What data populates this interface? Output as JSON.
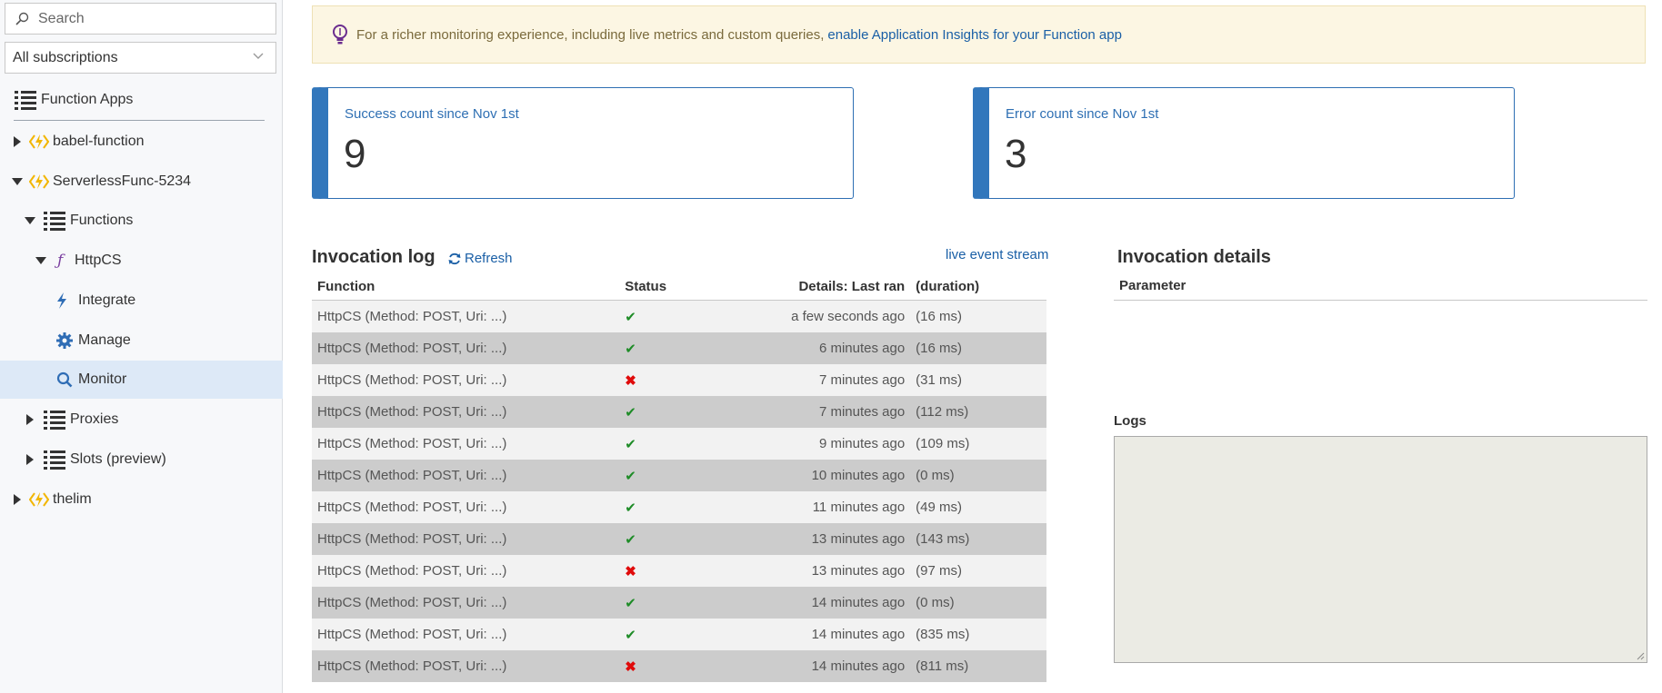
{
  "sidebar": {
    "search_placeholder": "Search",
    "subscription": "All subscriptions",
    "tree": [
      {
        "label": "Function Apps",
        "icon": "list-icon"
      },
      {
        "label": "babel-function",
        "icon": "function-app-icon"
      },
      {
        "label": "ServerlessFunc-5234",
        "icon": "function-app-icon"
      },
      {
        "label": "Functions",
        "icon": "list-icon"
      },
      {
        "label": "HttpCS",
        "icon": "function-icon"
      },
      {
        "label": "Integrate",
        "icon": "lightning-icon"
      },
      {
        "label": "Manage",
        "icon": "gear-icon"
      },
      {
        "label": "Monitor",
        "icon": "search-icon"
      },
      {
        "label": "Proxies",
        "icon": "list-icon"
      },
      {
        "label": "Slots (preview)",
        "icon": "list-icon"
      },
      {
        "label": "thelim",
        "icon": "function-app-icon"
      }
    ]
  },
  "banner": {
    "text": "For a richer monitoring experience, including live metrics and custom queries,",
    "link": "enable Application Insights for your Function app"
  },
  "cards": {
    "success": {
      "title": "Success count since Nov 1st",
      "value": "9"
    },
    "error": {
      "title": "Error count since Nov 1st",
      "value": "3"
    }
  },
  "invocation_log": {
    "title": "Invocation log",
    "refresh": "Refresh",
    "live_stream": "live event stream",
    "columns": {
      "function": "Function",
      "status": "Status",
      "last_ran": "Details: Last ran",
      "duration": "(duration)"
    },
    "rows": [
      {
        "function": "HttpCS (Method: POST, Uri: ...)",
        "status": "success",
        "last_ran": "a few seconds ago",
        "duration": "(16 ms)"
      },
      {
        "function": "HttpCS (Method: POST, Uri: ...)",
        "status": "success",
        "last_ran": "6 minutes ago",
        "duration": "(16 ms)"
      },
      {
        "function": "HttpCS (Method: POST, Uri: ...)",
        "status": "error",
        "last_ran": "7 minutes ago",
        "duration": "(31 ms)"
      },
      {
        "function": "HttpCS (Method: POST, Uri: ...)",
        "status": "success",
        "last_ran": "7 minutes ago",
        "duration": "(112 ms)"
      },
      {
        "function": "HttpCS (Method: POST, Uri: ...)",
        "status": "success",
        "last_ran": "9 minutes ago",
        "duration": "(109 ms)"
      },
      {
        "function": "HttpCS (Method: POST, Uri: ...)",
        "status": "success",
        "last_ran": "10 minutes ago",
        "duration": "(0 ms)"
      },
      {
        "function": "HttpCS (Method: POST, Uri: ...)",
        "status": "success",
        "last_ran": "11 minutes ago",
        "duration": "(49 ms)"
      },
      {
        "function": "HttpCS (Method: POST, Uri: ...)",
        "status": "success",
        "last_ran": "13 minutes ago",
        "duration": "(143 ms)"
      },
      {
        "function": "HttpCS (Method: POST, Uri: ...)",
        "status": "error",
        "last_ran": "13 minutes ago",
        "duration": "(97 ms)"
      },
      {
        "function": "HttpCS (Method: POST, Uri: ...)",
        "status": "success",
        "last_ran": "14 minutes ago",
        "duration": "(0 ms)"
      },
      {
        "function": "HttpCS (Method: POST, Uri: ...)",
        "status": "success",
        "last_ran": "14 minutes ago",
        "duration": "(835 ms)"
      },
      {
        "function": "HttpCS (Method: POST, Uri: ...)",
        "status": "error",
        "last_ran": "14 minutes ago",
        "duration": "(811 ms)"
      }
    ]
  },
  "invocation_details": {
    "title": "Invocation details",
    "parameter_header": "Parameter",
    "logs_label": "Logs"
  },
  "colors": {
    "accent": "#3277bc",
    "success": "#1e8c27",
    "error": "#e00b0b",
    "selected_bg": "#dde9f7",
    "banner_bg": "#fcf6e3"
  }
}
